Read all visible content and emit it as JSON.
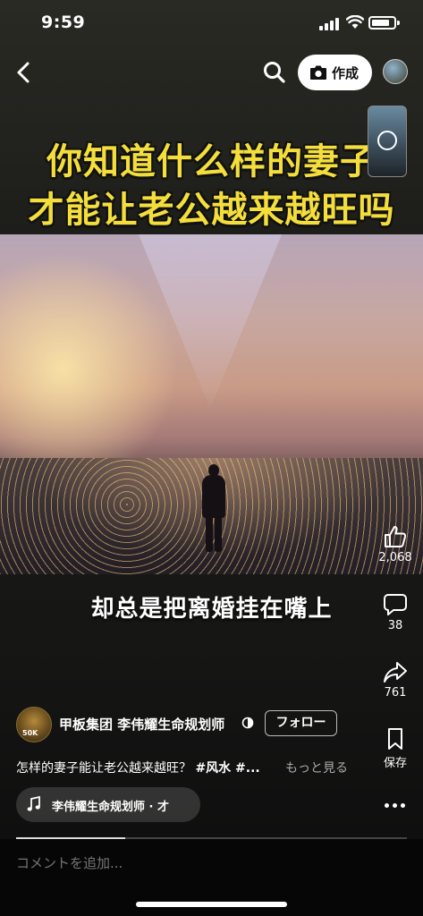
{
  "status_bar": {
    "time": "9:59"
  },
  "top_nav": {
    "create_label": "作成"
  },
  "video": {
    "title_line1": "你知道什么样的妻子",
    "title_line2": "才能让老公越来越旺吗",
    "subtitle": "却总是把离婚挂在嘴上",
    "progress_fraction": 0.28
  },
  "actions": {
    "likes": "2,068",
    "comments": "38",
    "shares": "761",
    "save_label": "保存"
  },
  "author": {
    "name": "甲板集团 李伟耀生命规划师",
    "follow_label": "フォロー",
    "avatar_badge": "50K"
  },
  "caption": {
    "text": "怎样的妻子能让老公越来越旺？",
    "hashtags": "#风水 #...",
    "see_more": "もっと見る"
  },
  "music": {
    "label": "李伟耀生命规划师 · 才"
  },
  "comment": {
    "placeholder": "コメントを追加..."
  },
  "colors": {
    "title_yellow": "#f4de3c",
    "background": "#161615"
  }
}
